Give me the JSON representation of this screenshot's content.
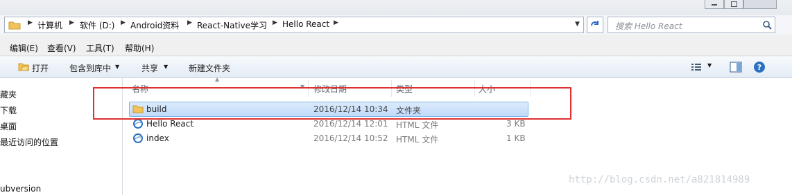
{
  "address": {
    "crumbs": [
      "计算机",
      "软件 (D:)",
      "Android资料",
      "React-Native学习",
      "Hello React"
    ],
    "search_placeholder": "搜索 Hello React"
  },
  "menubar": [
    "编辑(E)",
    "查看(V)",
    "工具(T)",
    "帮助(H)"
  ],
  "toolbar": {
    "open": "打开",
    "include_library": "包含到库中",
    "share": "共享",
    "new_folder": "新建文件夹"
  },
  "nav": [
    "藏夹",
    "下载",
    "桌面",
    "最近访问的位置",
    "ubversion"
  ],
  "columns": {
    "name": "名称",
    "date": "修改日期",
    "type": "类型",
    "size": "大小"
  },
  "files": [
    {
      "name": "build",
      "date": "2016/12/14 10:34",
      "type": "文件夹",
      "size": ""
    },
    {
      "name": "Hello React",
      "date": "2016/12/14 12:01",
      "type": "HTML 文件",
      "size": "3 KB"
    },
    {
      "name": "index",
      "date": "2016/12/14 10:52",
      "type": "HTML 文件",
      "size": "1 KB"
    }
  ],
  "watermark": "http://blog.csdn.net/a821814989",
  "colors": {
    "highlight_box": "#e03030",
    "selection": "#c1dbfc"
  },
  "icons": [
    "folder-icon",
    "chevron-right-icon",
    "dropdown-arrow-icon",
    "refresh-icon",
    "search-icon",
    "open-icon",
    "view-options-icon",
    "preview-pane-icon",
    "help-icon",
    "html-file-icon"
  ]
}
